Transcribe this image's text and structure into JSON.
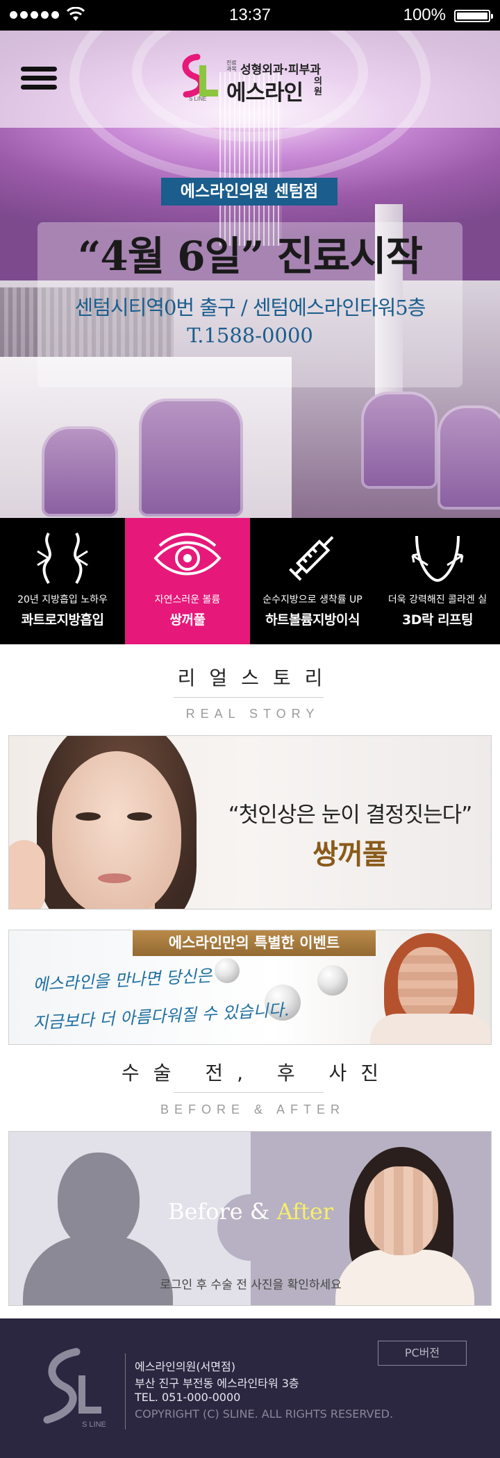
{
  "status_bar": {
    "time": "13:37",
    "battery": "100%",
    "battery_level": 1.0,
    "signal_bars": 5
  },
  "header": {
    "logo": {
      "sub_small": "진료과목",
      "sub_depts": "성형외과·피부과",
      "name": "에스라인",
      "name_small": "의원",
      "mark_text": "S LINE"
    }
  },
  "hero": {
    "badge": "에스라인의원 센텀점",
    "title": "“4월 6일” 진료시작",
    "subtitle": "센텀시티역0번 출구 / 센텀에스라인타워5층",
    "tel": "T.1588-0000"
  },
  "services": [
    {
      "icon": "liposuction-icon",
      "sub": "20년 지방흡입 노하우",
      "main": "콰트로지방흡입",
      "active": false
    },
    {
      "icon": "eye-icon",
      "sub": "자연스러운 볼륨",
      "main": "쌍꺼풀",
      "active": true
    },
    {
      "icon": "syringe-icon",
      "sub": "순수지방으로 생착률 UP",
      "main": "하트볼륨지방이식",
      "active": false
    },
    {
      "icon": "face-lift-icon",
      "sub": "더욱 강력해진 콜라겐 실",
      "main": "3D락 리프팅",
      "active": false
    }
  ],
  "real_story": {
    "title": "리얼스토리",
    "title_en": "REAL STORY",
    "banner_quote": "“첫인상은 눈이 결정짓는다”",
    "banner_main": "쌍꺼풀"
  },
  "event": {
    "tag": "에스라인만의 특별한 이벤트",
    "line1": "에스라인을 만나면 당신은",
    "line2": "지금보다 더 아름다워질 수 있습니다."
  },
  "before_after": {
    "title": "수술 전, 후 사진",
    "title_en": "BEFORE & AFTER",
    "banner_before": "Before",
    "banner_amp": "&",
    "banner_after": "After",
    "note": "로그인 후 수술 전 사진을 확인하세요"
  },
  "footer": {
    "clinic_name": "에스라인의원(서면점)",
    "address": "부산 진구 부전동 에스라인타워 3층",
    "tel": "TEL. 051-000-0000",
    "copyright": "COPYRIGHT (C) SLINE. ALL RIGHTS RESERVED.",
    "pc_button": "PC버전",
    "logo_text": "S LINE"
  },
  "colors": {
    "accent_pink": "#e6197a",
    "brand_blue": "#1b5d8c",
    "gold": "#946a33",
    "footer_bg": "#2b2741"
  }
}
